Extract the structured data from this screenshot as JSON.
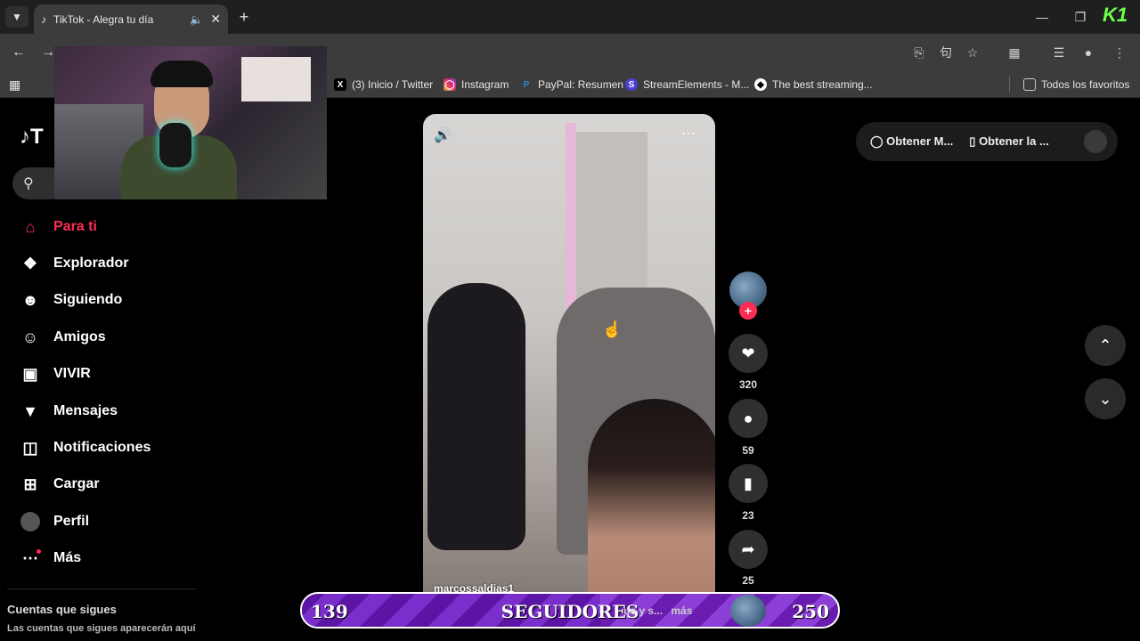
{
  "browser": {
    "tab_title": "TikTok - Alegra tu día",
    "bookmarks": [
      {
        "label": "(3) Inicio / Twitter",
        "icon": "x-icon"
      },
      {
        "label": "Instagram",
        "icon": "instagram-icon"
      },
      {
        "label": "PayPal: Resumen",
        "icon": "paypal-icon"
      },
      {
        "label": "StreamElements - M...",
        "icon": "streamelements-icon"
      },
      {
        "label": "The best streaming...",
        "icon": "streaming-icon"
      }
    ],
    "all_bookmarks": "Todos los favoritos",
    "overlay_logo": "K1"
  },
  "sidebar": {
    "logo": "T",
    "items": [
      {
        "label": "Para ti",
        "icon": "home-icon",
        "active": true
      },
      {
        "label": "Explorador",
        "icon": "compass-icon"
      },
      {
        "label": "Siguiendo",
        "icon": "following-icon"
      },
      {
        "label": "Amigos",
        "icon": "friends-icon"
      },
      {
        "label": "VIVIR",
        "icon": "live-icon"
      },
      {
        "label": "Mensajes",
        "icon": "messages-icon"
      },
      {
        "label": "Notificaciones",
        "icon": "notifications-icon"
      },
      {
        "label": "Cargar",
        "icon": "upload-icon"
      },
      {
        "label": "Perfil",
        "icon": "profile-avatar"
      },
      {
        "label": "Más",
        "icon": "more-icon"
      }
    ],
    "following_title": "Cuentas que sigues",
    "following_desc": "Las cuentas que sigues aparecerán aquí"
  },
  "header": {
    "get_coins": "Obtener M...",
    "get_app": "Obtener la ..."
  },
  "video": {
    "author": "marcossaldias1",
    "caption_tail": "ue y s...",
    "caption_more": "más"
  },
  "actions": {
    "likes": "320",
    "comments": "59",
    "saves": "23",
    "shares": "25"
  },
  "follower_goal": {
    "current": "139",
    "label": "SEGUIDORES",
    "goal": "250",
    "progress": 0.556
  },
  "colors": {
    "accent": "#fe2c55",
    "bar_purple": "#6a1bb0"
  }
}
